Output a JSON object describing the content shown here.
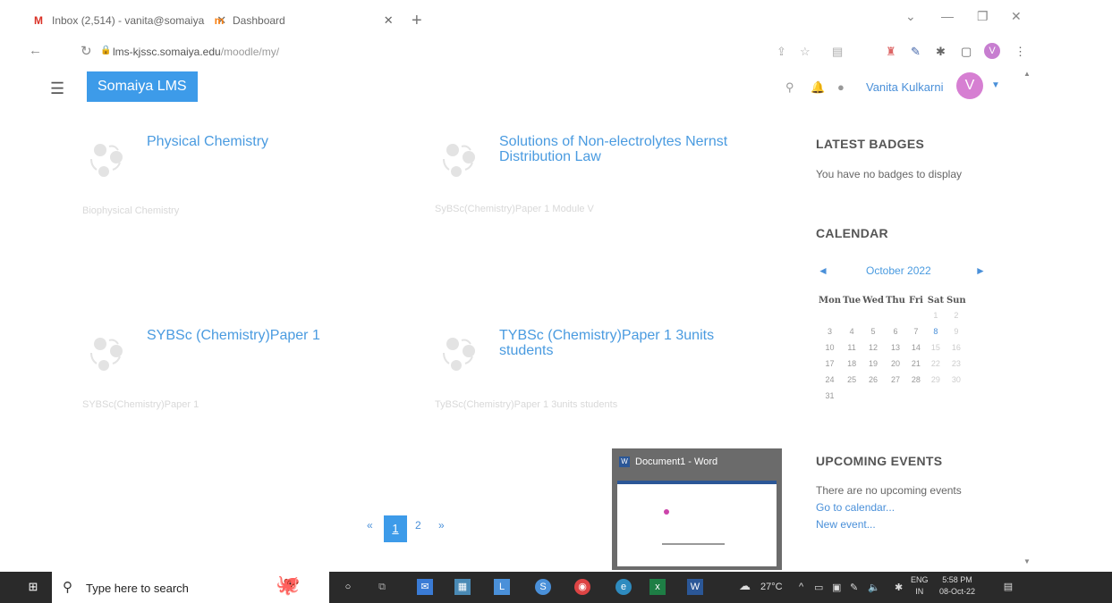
{
  "browser": {
    "tabs": [
      {
        "title": "Inbox (2,514) - vanita@somaiya",
        "icon": "gmail-icon"
      },
      {
        "title": "Dashboard",
        "icon": "moodle-icon"
      }
    ],
    "url_host": "lms-kjssc.somaiya.edu",
    "url_path": "/moodle/my/",
    "profile_initial": "V"
  },
  "header": {
    "brand": "Somaiya LMS",
    "user_name": "Vanita Kulkarni",
    "avatar_initial": "V"
  },
  "courses": [
    {
      "title": "Physical Chemistry",
      "category": "Biophysical Chemistry"
    },
    {
      "title": "Solutions of Non-electrolytes Nernst Distribution Law",
      "category": "SyBSc(Chemistry)Paper 1 Module V"
    },
    {
      "title": "SYBSc (Chemistry)Paper 1",
      "category": "SYBSc(Chemistry)Paper 1"
    },
    {
      "title": "TYBSc (Chemistry)Paper 1 3units students",
      "category": "TyBSc(Chemistry)Paper 1 3units students"
    }
  ],
  "pagination": {
    "prev": "«",
    "current": "1",
    "next_page": "2",
    "next": "»"
  },
  "blocks": {
    "badges_title": "LATEST BADGES",
    "badges_text": "You have no badges to display",
    "calendar_title": "CALENDAR",
    "calendar_month": "October 2022",
    "calendar_prev": "◄",
    "calendar_next": "►",
    "weekdays": [
      "Mon",
      "Tue",
      "Wed",
      "Thu",
      "Fri",
      "Sat",
      "Sun"
    ],
    "weeks": [
      [
        "",
        "",
        "",
        "",
        "",
        "1",
        "2"
      ],
      [
        "3",
        "4",
        "5",
        "6",
        "7",
        "8",
        "9"
      ],
      [
        "10",
        "11",
        "12",
        "13",
        "14",
        "15",
        "16"
      ],
      [
        "17",
        "18",
        "19",
        "20",
        "21",
        "22",
        "23"
      ],
      [
        "24",
        "25",
        "26",
        "27",
        "28",
        "29",
        "30"
      ],
      [
        "31",
        "",
        "",
        "",
        "",
        "",
        ""
      ]
    ],
    "events_title": "UPCOMING EVENTS",
    "events_text": "There are no upcoming events",
    "go_calendar": "Go to calendar...",
    "new_event": "New event..."
  },
  "taskbar": {
    "search_placeholder": "Type here to search",
    "weather": "27°C",
    "lang_top": "ENG",
    "lang_bottom": "IN",
    "time": "5:58 PM",
    "date": "08-Oct-22",
    "word_preview_title": "Document1 - Word"
  }
}
